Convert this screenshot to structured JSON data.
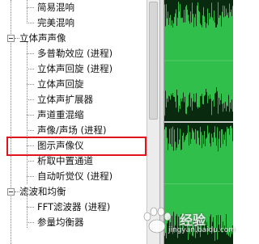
{
  "tree": {
    "items": [
      {
        "label": "简易混响",
        "level": 2,
        "kind": "leaf"
      },
      {
        "label": "完美混响",
        "level": 2,
        "kind": "leaf"
      },
      {
        "label": "立体声声像",
        "level": 1,
        "kind": "folder"
      },
      {
        "label": "多普勒效应 (进程)",
        "level": 2,
        "kind": "leaf"
      },
      {
        "label": "立体声回旋 (进程)",
        "level": 2,
        "kind": "leaf"
      },
      {
        "label": "立体声回旋",
        "level": 2,
        "kind": "leaf"
      },
      {
        "label": "立体声扩展器",
        "level": 2,
        "kind": "leaf"
      },
      {
        "label": "声道重混缩",
        "level": 2,
        "kind": "leaf"
      },
      {
        "label": "声像/声场 (进程)",
        "level": 2,
        "kind": "leaf"
      },
      {
        "label": "图示声像仪",
        "level": 2,
        "kind": "leaf"
      },
      {
        "label": "析取中置通道",
        "level": 2,
        "kind": "leaf",
        "highlighted": true
      },
      {
        "label": "自动听觉仪 (进程)",
        "level": 2,
        "kind": "leaf"
      },
      {
        "label": "滤波和均衡",
        "level": 1,
        "kind": "folder"
      },
      {
        "label": "FFT滤波器 (进程)",
        "level": 2,
        "kind": "leaf"
      },
      {
        "label": "参量均衡器",
        "level": 2,
        "kind": "leaf"
      }
    ]
  },
  "watermark": {
    "brand": "经验",
    "url": "jingyan.baidu.com"
  },
  "colors": {
    "highlight_border": "#e0141c",
    "waveform": "#2fbf4a",
    "waveform_bg": "#0a2a10"
  }
}
